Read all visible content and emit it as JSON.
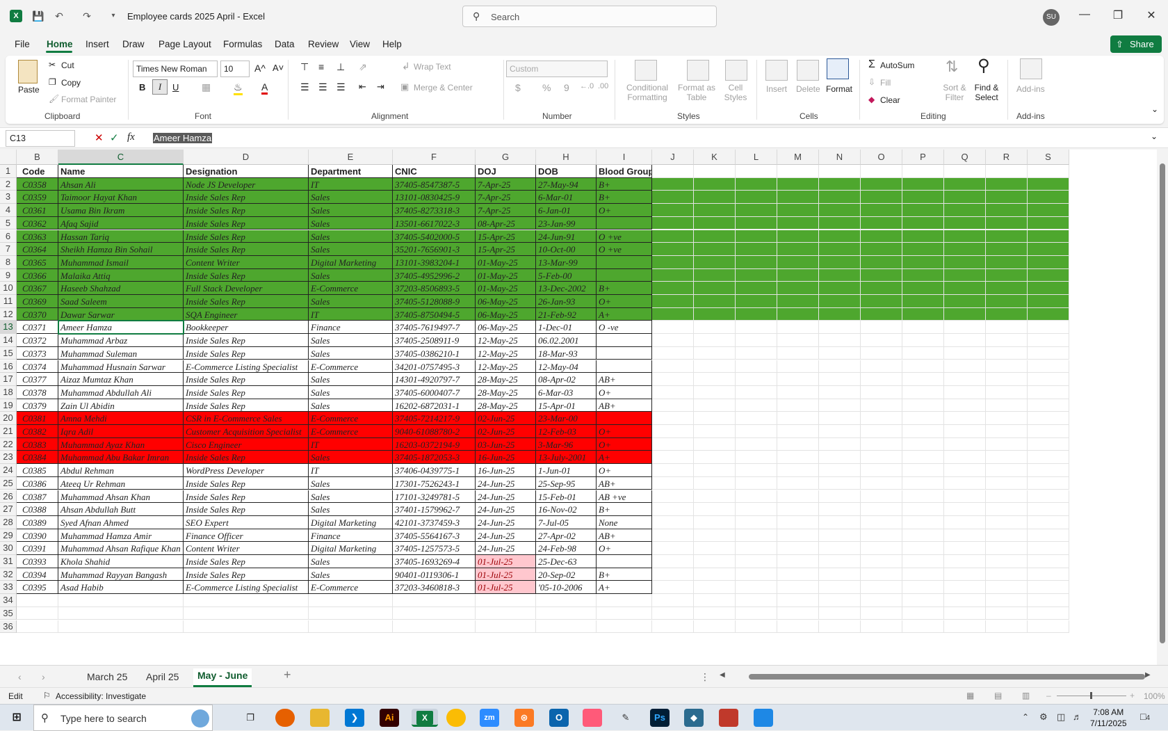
{
  "window": {
    "title": "Employee cards 2025 April  -  Excel",
    "search_placeholder": "Search",
    "user_initials": "SU"
  },
  "menu": [
    "File",
    "Home",
    "Insert",
    "Draw",
    "Page Layout",
    "Formulas",
    "Data",
    "Review",
    "View",
    "Help"
  ],
  "share_label": "Share",
  "ribbon": {
    "clipboard": {
      "paste": "Paste",
      "cut": "Cut",
      "copy": "Copy",
      "format_painter": "Format Painter",
      "label": "Clipboard"
    },
    "font": {
      "name": "Times New Roman",
      "size": "10",
      "bold": "B",
      "italic": "I",
      "underline": "U",
      "grow": "A^",
      "shrink": "A˅",
      "label": "Font"
    },
    "alignment": {
      "wrap": "Wrap Text",
      "merge": "Merge & Center",
      "label": "Alignment"
    },
    "number": {
      "format": "Custom",
      "currency": "$",
      "percent": "%",
      "comma": "9",
      "label": "Number"
    },
    "styles": {
      "conditional": "Conditional Formatting",
      "format_table": "Format as Table",
      "cell_styles": "Cell Styles",
      "label": "Styles"
    },
    "cells": {
      "insert": "Insert",
      "delete": "Delete",
      "format": "Format",
      "label": "Cells"
    },
    "editing": {
      "autosum": "AutoSum",
      "fill": "Fill",
      "clear": "Clear",
      "sort": "Sort & Filter",
      "find": "Find & Select",
      "label": "Editing"
    },
    "addins": {
      "addins": "Add-ins",
      "label": "Add-ins"
    }
  },
  "formula_bar": {
    "name_box": "C13",
    "fx": "fx",
    "value": "Ameer Hamza"
  },
  "columns": [
    "B",
    "C",
    "D",
    "E",
    "F",
    "G",
    "H",
    "I",
    "J",
    "K",
    "L",
    "M",
    "N",
    "O",
    "P",
    "Q",
    "R",
    "S"
  ],
  "header_row": [
    "Code",
    "Name",
    "Designation",
    "Department",
    "CNIC",
    "DOJ",
    "DOB",
    "Blood Group"
  ],
  "rows": [
    [
      "C0358",
      "Ahsan Ali",
      "Node JS Developer",
      "IT",
      "37405-8547387-5",
      "7-Apr-25",
      "27-May-94",
      "B+"
    ],
    [
      "C0359",
      "Taimoor Hayat Khan",
      "Inside Sales Rep",
      "Sales",
      "13101-0830425-9",
      "7-Apr-25",
      "6-Mar-01",
      "B+"
    ],
    [
      "C0361",
      "Usama Bin Ikram",
      "Inside Sales Rep",
      "Sales",
      "37405-8273318-3",
      "7-Apr-25",
      "6-Jan-01",
      "O+"
    ],
    [
      "C0362",
      "Afaq Sajid",
      "Inside Sales Rep",
      "Sales",
      "13501-6617022-3",
      "08-Apr-25",
      "23-Jan-99",
      ""
    ],
    [
      "C0363",
      "Hassan Tariq",
      "Inside Sales Rep",
      "Sales",
      "37405-5402000-5",
      "15-Apr-25",
      "24-Jun-91",
      "O +ve"
    ],
    [
      "C0364",
      "Sheikh Hamza Bin Sohail",
      "Inside Sales Rep",
      "Sales",
      "35201-7656901-3",
      "15-Apr-25",
      "10-Oct-00",
      "O +ve"
    ],
    [
      "C0365",
      "Muhammad Ismail",
      "Content Writer",
      "Digital Marketing",
      "13101-3983204-1",
      "01-May-25",
      "13-Mar-99",
      ""
    ],
    [
      "C0366",
      "Malaika Attiq",
      "Inside Sales Rep",
      "Sales",
      "37405-4952996-2",
      "01-May-25",
      "5-Feb-00",
      ""
    ],
    [
      "C0367",
      "Haseeb Shahzad",
      "Full Stack Developer",
      "E-Commerce",
      "37203-8506893-5",
      "01-May-25",
      "13-Dec-2002",
      "B+"
    ],
    [
      "C0369",
      "Saad Saleem",
      "Inside Sales Rep",
      "Sales",
      "37405-5128088-9",
      "06-May-25",
      "26-Jan-93",
      "O+"
    ],
    [
      "C0370",
      "Dawar Sarwar",
      "SQA Engineer",
      "IT",
      "37405-8750494-5",
      "06-May-25",
      "21-Feb-92",
      "A+"
    ],
    [
      "C0371",
      "Ameer Hamza",
      "Bookkeeper",
      "Finance",
      "37405-7619497-7",
      "06-May-25",
      "1-Dec-01",
      "O -ve"
    ],
    [
      "C0372",
      "Muhammad Arbaz",
      "Inside Sales Rep",
      "Sales",
      "37405-2508911-9",
      "12-May-25",
      "06.02.2001",
      ""
    ],
    [
      "C0373",
      "Muhammad Suleman",
      "Inside Sales Rep",
      "Sales",
      "37405-0386210-1",
      "12-May-25",
      "18-Mar-93",
      ""
    ],
    [
      "C0374",
      "Muhammad Husnain Sarwar",
      "E-Commerce Listing Specialist",
      "E-Commerce",
      "34201-0757495-3",
      "12-May-25",
      "12-May-04",
      ""
    ],
    [
      "C0377",
      "Aizaz Mumtaz Khan",
      "Inside Sales Rep",
      "Sales",
      "14301-4920797-7",
      "28-May-25",
      "08-Apr-02",
      "AB+"
    ],
    [
      "C0378",
      "Muhammad Abdullah Ali",
      "Inside Sales Rep",
      "Sales",
      "37405-6000407-7",
      "28-May-25",
      "6-Mar-03",
      "O+"
    ],
    [
      "C0379",
      "Zain Ul Abidin",
      "Inside Sales Rep",
      "Sales",
      "16202-6872031-1",
      "28-May-25",
      "15-Apr-01",
      "AB+"
    ],
    [
      "C0381",
      "Amna Mehdi",
      "CSR in E-Commerce Sales",
      "E-Commerce",
      "37405-7214217-9",
      "02-Jun-25",
      "23-Mar-00",
      ""
    ],
    [
      "C0382",
      "Iqra Adil",
      "Customer Acquisition Specialist",
      "E-Commerce",
      "9040-61088780-2",
      "02-Jun-25",
      "12-Feb-03",
      "O+"
    ],
    [
      "C0383",
      "Muhammad Ayaz Khan",
      "Cisco Engineer",
      "IT",
      "16203-0372194-9",
      "03-Jun-25",
      "3-Mar-96",
      "O+"
    ],
    [
      "C0384",
      "Muhammad Abu Bakar Imran",
      "Inside Sales Rep",
      "Sales",
      "37405-1872053-3",
      "16-Jun-25",
      "13-July-2001",
      "A+"
    ],
    [
      "C0385",
      "Abdul Rehman",
      "WordPress Developer",
      "IT",
      "37406-0439775-1",
      "16-Jun-25",
      "1-Jun-01",
      "O+"
    ],
    [
      "C0386",
      "Ateeq Ur Rehman",
      "Inside Sales Rep",
      "Sales",
      "17301-7526243-1",
      "24-Jun-25",
      "25-Sep-95",
      "AB+"
    ],
    [
      "C0387",
      "Muhammad Ahsan Khan",
      "Inside Sales Rep",
      "Sales",
      "17101-3249781-5",
      "24-Jun-25",
      "15-Feb-01",
      "AB +ve"
    ],
    [
      "C0388",
      "Ahsan Abdullah Butt",
      "Inside Sales Rep",
      "Sales",
      "37401-1579962-7",
      "24-Jun-25",
      "16-Nov-02",
      "B+"
    ],
    [
      "C0389",
      "Syed Afnan Ahmed",
      "SEO Expert",
      "Digital Marketing",
      "42101-3737459-3",
      "24-Jun-25",
      "7-Jul-05",
      "None"
    ],
    [
      "C0390",
      "Muhammad Hamza Amir",
      "Finance Officer",
      "Finance",
      "37405-5564167-3",
      "24-Jun-25",
      "27-Apr-02",
      "AB+"
    ],
    [
      "C0391",
      "Muhammad Ahsan Rafique Khan",
      "Content Writer",
      "Digital Marketing",
      "37405-1257573-5",
      "24-Jun-25",
      "24-Feb-98",
      "O+"
    ],
    [
      "C0393",
      "Khola Shahid",
      "Inside Sales Rep",
      "Sales",
      "37405-1693269-4",
      "01-Jul-25",
      "25-Dec-63",
      ""
    ],
    [
      "C0394",
      "Muhammad Rayyan Bangash",
      "Inside Sales Rep",
      "Sales",
      "90401-0119306-1",
      "01-Jul-25",
      "20-Sep-02",
      "B+"
    ],
    [
      "C0395",
      "Asad Habib",
      "E-Commerce Listing Specialist",
      "E-Commerce",
      "37203-3460818-3",
      "01-Jul-25",
      "'05-10-2006",
      "A+"
    ]
  ],
  "row_fill": [
    "green",
    "green",
    "green",
    "green",
    "green",
    "green",
    "green",
    "green",
    "green",
    "green",
    "green",
    "",
    "",
    "",
    "",
    "",
    "",
    "",
    "red",
    "red",
    "red",
    "red",
    "",
    "",
    "",
    "",
    "",
    "",
    "",
    "pink",
    "pink",
    "pink"
  ],
  "colors": {
    "green": "#4ea72e",
    "red": "#ff0000",
    "pink": "#ffc7ce",
    "accent": "#107c41"
  },
  "sheets": [
    "March 25",
    "April 25",
    "May - June"
  ],
  "active_sheet": "May - June",
  "status": {
    "mode": "Edit",
    "accessibility": "Accessibility: Investigate",
    "zoom": "100%"
  },
  "taskbar": {
    "search_placeholder": "Type here to search",
    "time": "7:08 AM",
    "date": "7/11/2025",
    "notifications": "4"
  }
}
